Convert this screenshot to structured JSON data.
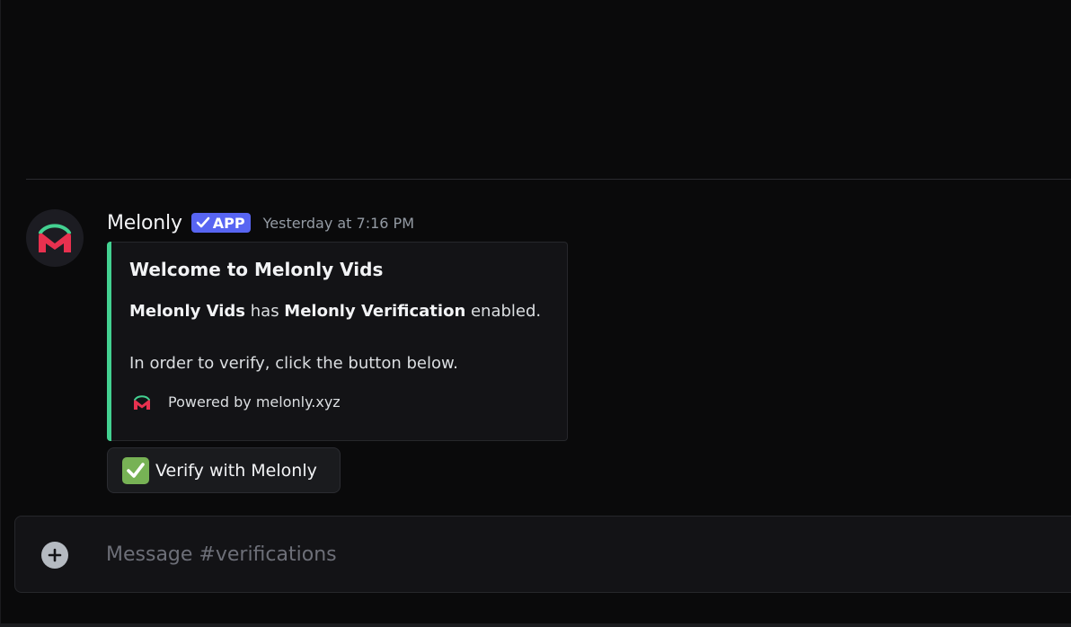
{
  "message": {
    "username": "Melonly",
    "app_tag": "APP",
    "timestamp": "Yesterday at 7:16 PM",
    "avatar_icon": "melonly-logo-icon"
  },
  "embed": {
    "accent_color": "#43d191",
    "title": "Welcome to Melonly Vids",
    "line1": {
      "server": "Melonly Vids",
      "middle": " has ",
      "feature": "Melonly Verification",
      "end": " enabled."
    },
    "line2": "In order to verify, click the button below.",
    "footer": {
      "icon": "melonly-logo-icon",
      "text": "Powered by melonly.xyz"
    }
  },
  "verify_button": {
    "emoji": "check-mark-button-icon",
    "label": "Verify with Melonly"
  },
  "composer": {
    "add_icon": "plus-circle-icon",
    "placeholder": "Message #verifications"
  },
  "colors": {
    "background": "#0a0a0b",
    "app_tag": "#5865f2",
    "brand_red": "#e8314f",
    "brand_green": "#43d191"
  }
}
